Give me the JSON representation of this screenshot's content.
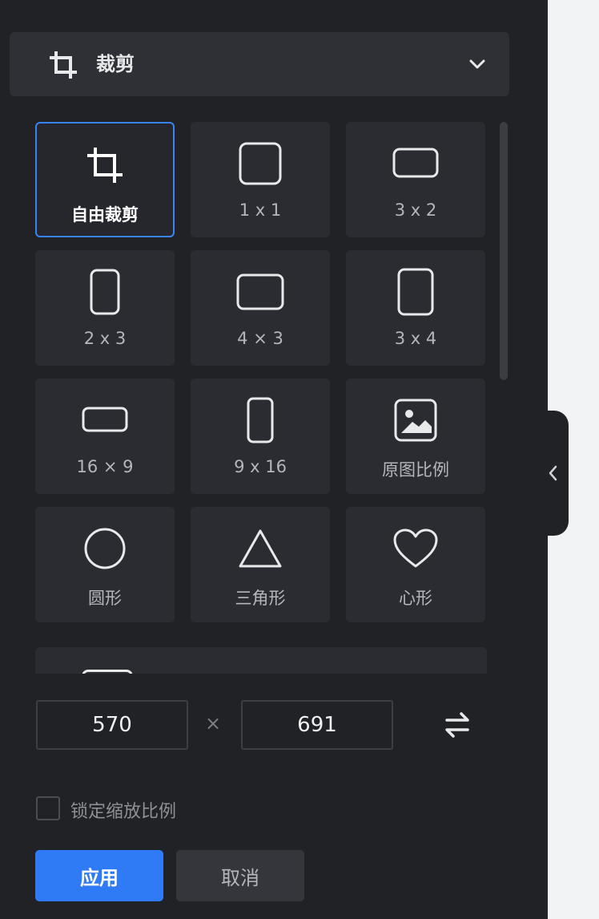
{
  "header": {
    "title": "裁剪",
    "icon": "crop-icon",
    "chevron_icon": "chevron-down-icon"
  },
  "presets": [
    {
      "id": "free",
      "label": "自由裁剪",
      "icon": "crop-icon",
      "selected": true
    },
    {
      "id": "1x1",
      "label": "1 x 1",
      "icon": "square-icon",
      "selected": false
    },
    {
      "id": "3x2",
      "label": "3 x 2",
      "icon": "rect-landscape-icon",
      "selected": false
    },
    {
      "id": "2x3",
      "label": "2 x 3",
      "icon": "rect-portrait-icon",
      "selected": false
    },
    {
      "id": "4x3",
      "label": "4 × 3",
      "icon": "rect-landscape-icon",
      "selected": false
    },
    {
      "id": "3x4",
      "label": "3 x 4",
      "icon": "rect-portrait-icon",
      "selected": false
    },
    {
      "id": "16x9",
      "label": "16 × 9",
      "icon": "rect-wide-icon",
      "selected": false
    },
    {
      "id": "9x16",
      "label": "9 x 16",
      "icon": "rect-tall-icon",
      "selected": false
    },
    {
      "id": "original",
      "label": "原图比例",
      "icon": "image-icon",
      "selected": false
    },
    {
      "id": "circle",
      "label": "圆形",
      "icon": "circle-icon",
      "selected": false
    },
    {
      "id": "triangle",
      "label": "三角形",
      "icon": "triangle-icon",
      "selected": false
    },
    {
      "id": "heart",
      "label": "心形",
      "icon": "heart-icon",
      "selected": false
    }
  ],
  "dimensions": {
    "width": "570",
    "height": "691",
    "separator": "×",
    "swap_icon": "swap-icon"
  },
  "lock_ratio": {
    "label": "锁定缩放比例",
    "checked": false
  },
  "buttons": {
    "apply": "应用",
    "cancel": "取消"
  },
  "colors": {
    "panel_bg": "#202226",
    "tile_bg": "#2a2c31",
    "accent": "#2f7bf5",
    "selected_border": "#3b82f6"
  }
}
